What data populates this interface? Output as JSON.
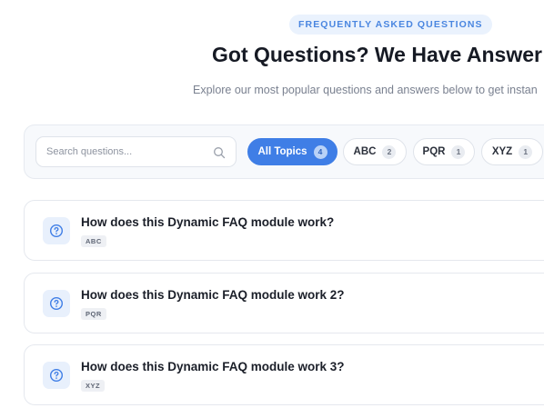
{
  "header": {
    "eyebrow": "FREQUENTLY ASKED QUESTIONS",
    "title": "Got Questions? We Have Answer",
    "subtitle": "Explore our most popular questions and answers below to get instan"
  },
  "search": {
    "placeholder": "Search questions...",
    "value": "",
    "icon": "search-icon"
  },
  "topics": [
    {
      "label": "All Topics",
      "count": "4",
      "active": true
    },
    {
      "label": "ABC",
      "count": "2",
      "active": false
    },
    {
      "label": "PQR",
      "count": "1",
      "active": false
    },
    {
      "label": "XYZ",
      "count": "1",
      "active": false
    }
  ],
  "faqs": [
    {
      "question": "How does this Dynamic FAQ module work?",
      "tag": "ABC",
      "icon": "question-circle-icon"
    },
    {
      "question": "How does this Dynamic FAQ module work 2?",
      "tag": "PQR",
      "icon": "question-circle-icon"
    },
    {
      "question": "How does this Dynamic FAQ module work 3?",
      "tag": "XYZ",
      "icon": "question-circle-icon"
    }
  ],
  "colors": {
    "accent": "#3f7ee6",
    "eyebrow_bg": "#eaf2fd",
    "eyebrow_text": "#4a86e0",
    "icon_bg": "#e8f0fc"
  }
}
